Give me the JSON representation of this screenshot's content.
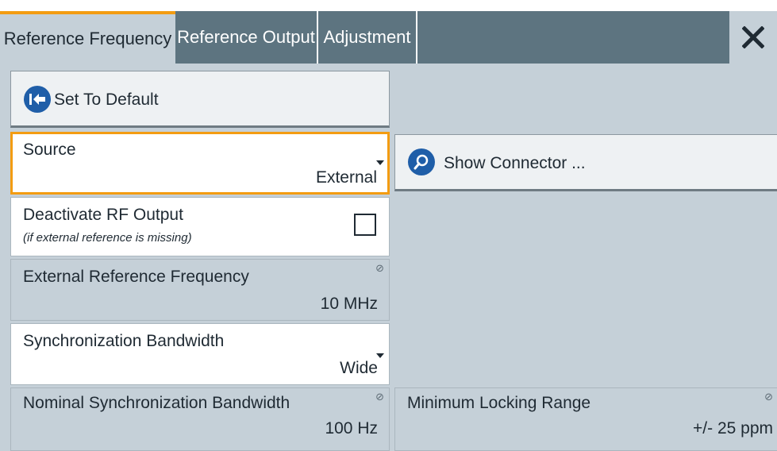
{
  "tabs": [
    {
      "label": "Reference Frequency",
      "active": true
    },
    {
      "label": "Reference Output",
      "active": false
    },
    {
      "label": "Adjustment",
      "active": false
    }
  ],
  "icons": {
    "close": "close-icon",
    "back": "arrow-left-icon",
    "search": "search-icon"
  },
  "colors": {
    "accent": "#f39c12",
    "tab_bar": "#5d7480",
    "panel": "#c5d0d8",
    "button_icon": "#1f5ea8"
  },
  "set_default": {
    "label": "Set To Default"
  },
  "source": {
    "label": "Source",
    "value": "External"
  },
  "show_connector": {
    "label": "Show Connector ..."
  },
  "deactivate_rf": {
    "label": "Deactivate RF Output",
    "hint": "(if external reference is missing)",
    "checked": false
  },
  "ext_ref_freq": {
    "label": "External Reference Frequency",
    "value": "10 MHz"
  },
  "sync_bw": {
    "label": "Synchronization Bandwidth",
    "value": "Wide"
  },
  "nominal_sync_bw": {
    "label": "Nominal Synchronization Bandwidth",
    "value": "100 Hz"
  },
  "min_locking_range": {
    "label": "Minimum Locking Range",
    "value": "+/- 25 ppm"
  }
}
